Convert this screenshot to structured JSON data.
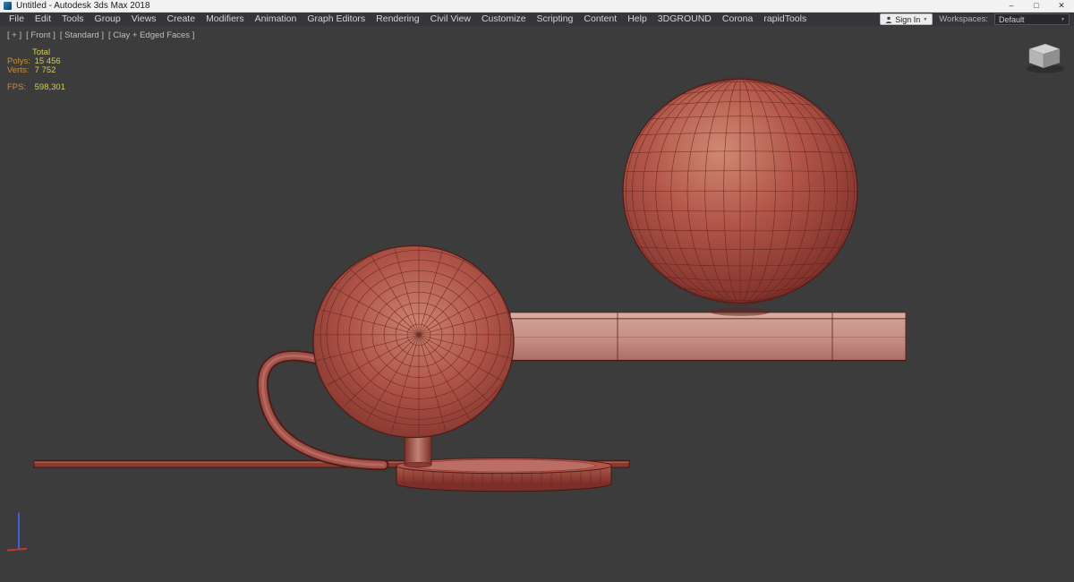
{
  "window": {
    "title": "Untitled - Autodesk 3ds Max 2018",
    "minimize": "–",
    "maximize": "□",
    "close": "✕"
  },
  "menu_bar": {
    "items": [
      "File",
      "Edit",
      "Tools",
      "Group",
      "Views",
      "Create",
      "Modifiers",
      "Animation",
      "Graph Editors",
      "Rendering",
      "Civil View",
      "Customize",
      "Scripting",
      "Content",
      "Help",
      "3DGROUND",
      "Corona",
      "rapidTools"
    ],
    "sign_in": "Sign In",
    "workspaces_label": "Workspaces:",
    "workspace_value": "Default"
  },
  "icons": {
    "dropdown_arrow": "▼"
  },
  "viewport": {
    "labels": {
      "general": "[ + ]",
      "view": "[ Front ]",
      "render_style": "[ Standard ]",
      "shading": "[ Clay + Edged Faces ]"
    },
    "stats": {
      "total": "Total",
      "polys_label": "Polys:",
      "polys_value": "15 456",
      "verts_label": "Verts:",
      "verts_value": "7 752",
      "fps_label": "FPS:",
      "fps_value": "598,301"
    },
    "colors": {
      "background": "#3c3c3c",
      "model_red": "#b2564b",
      "model_edge": "#5c221d",
      "stats_label": "#c9903a",
      "stats_value": "#d6cb52"
    }
  }
}
